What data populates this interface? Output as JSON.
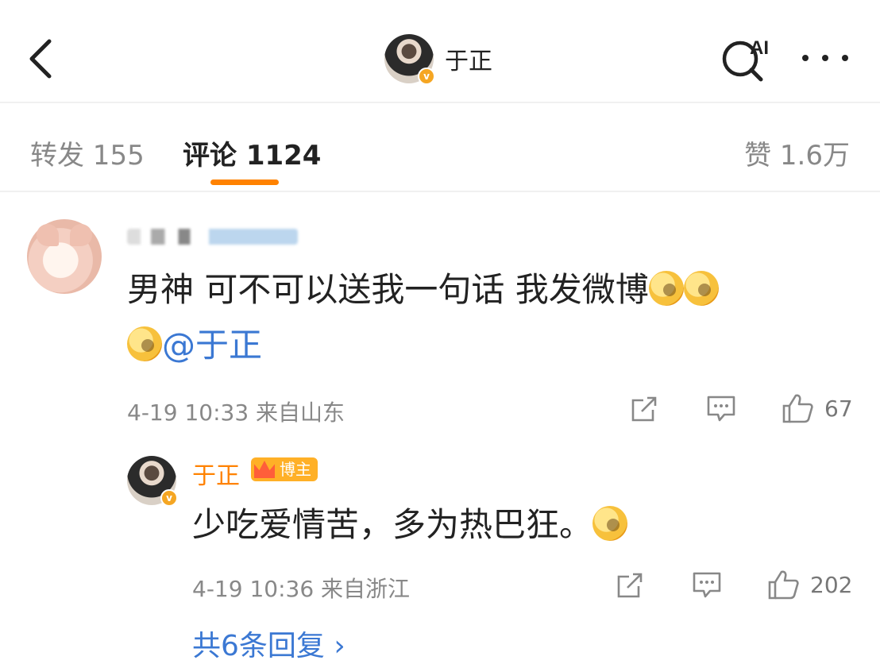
{
  "header": {
    "title": "于正",
    "ai_label": "AI"
  },
  "tabs": {
    "forward_label": "转发 155",
    "comments_label": "评论 1124",
    "likes_label": "赞 1.6万"
  },
  "comment": {
    "text_main": "男神 可不可以送我一句话 我发微博",
    "mention": "@于正",
    "time": "4-19 10:33",
    "location": "来自山东",
    "like_count": "67"
  },
  "reply": {
    "author": "于正",
    "badge": "博主",
    "text": "少吃爱情苦，多为热巴狂。",
    "time": "4-19 10:36",
    "location": "来自浙江",
    "like_count": "202",
    "more_replies": "共6条回复 ›"
  },
  "colors": {
    "accent_orange": "#ff8200",
    "link_blue": "#3b78d3",
    "muted_gray": "#888888"
  },
  "icons": [
    "back-arrow-icon",
    "ai-search-icon",
    "more-dots-icon",
    "share-icon",
    "comment-icon",
    "thumb-up-icon",
    "verified-badge-icon",
    "crown-icon",
    "emoji-icon"
  ]
}
